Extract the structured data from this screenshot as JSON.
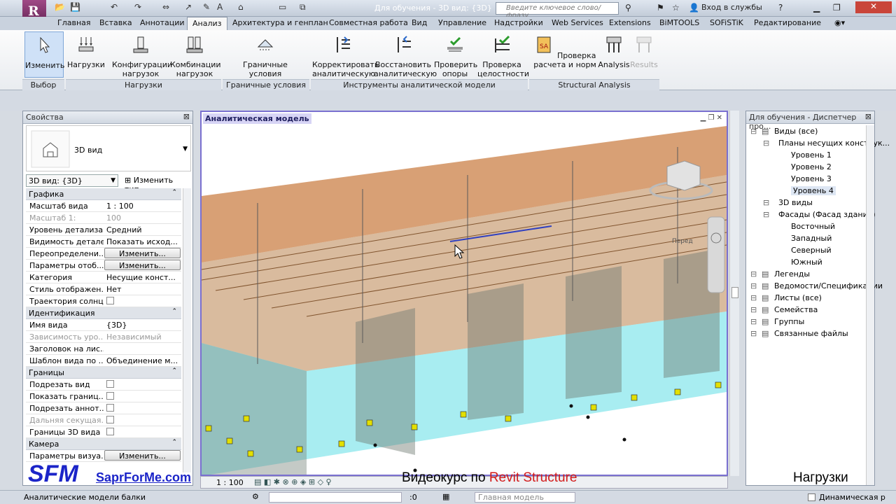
{
  "app": {
    "logo_letter": "R",
    "title": "Для обучения - 3D вид: {3D}",
    "search_placeholder": "Введите ключевое слово/фразу",
    "signin": "Вход в службы"
  },
  "tabs": [
    "Главная",
    "Вставка",
    "Аннотации",
    "Анализ",
    "Архитектура и генплан",
    "Совместная работа",
    "Вид",
    "Управление",
    "Надстройки",
    "Web Services",
    "Extensions",
    "BiMTOOLS",
    "SOFiSTiK",
    "Редактирование"
  ],
  "active_tab": "Анализ",
  "ribbon": {
    "buttons": [
      {
        "label": "Изменить",
        "icon": "cursor-icon"
      },
      {
        "label": "Нагрузки",
        "icon": "loads-icon"
      },
      {
        "label": "Конфигурации\nнагрузок",
        "icon": "load-configs-icon"
      },
      {
        "label": "Комбинации\nнагрузок",
        "icon": "load-combos-icon"
      },
      {
        "label": "Граничные\nусловия",
        "icon": "boundary-icon"
      },
      {
        "label": "Корректировать\nаналитическую",
        "icon": "adjust-icon"
      },
      {
        "label": "Восстановить\nаналитическую",
        "icon": "reset-icon"
      },
      {
        "label": "Проверить\nопоры",
        "icon": "check-supports-icon"
      },
      {
        "label": "Проверка\nцелостности",
        "icon": "consistency-icon"
      },
      {
        "label": "Проверка\nрасчета и норм",
        "icon": "code-check-icon"
      },
      {
        "label": "Analysis",
        "icon": "analysis-icon"
      },
      {
        "label": "Results",
        "icon": "results-icon"
      }
    ],
    "panels": [
      "Выбор",
      "Нагрузки",
      "Граничные условия",
      "Инструменты аналитической модели",
      "Structural Analysis"
    ]
  },
  "properties": {
    "title": "Свойства",
    "type_name": "3D вид",
    "view_selector": "3D вид: {3D}",
    "edit_type": "Изменить тип",
    "groups": {
      "graphics": "Графика",
      "identity": "Идентификация",
      "extents": "Границы",
      "camera": "Камера"
    },
    "rows": [
      {
        "k": "Масштаб вида",
        "v": "1 : 100"
      },
      {
        "k": "Масштаб   1:",
        "v": "100",
        "dis": true
      },
      {
        "k": "Уровень детализа...",
        "v": "Средний"
      },
      {
        "k": "Видимость деталей",
        "v": "Показать исход..."
      },
      {
        "k": "Переопределени...",
        "btn": "Изменить..."
      },
      {
        "k": "Параметры отоб...",
        "btn": "Изменить..."
      },
      {
        "k": "Категория",
        "v": "Несущие конст..."
      },
      {
        "k": "Стиль отображен...",
        "v": "Нет"
      },
      {
        "k": "Траектория солнца",
        "cb": true
      },
      {
        "k": "Имя вида",
        "v": "{3D}"
      },
      {
        "k": "Зависимость уро...",
        "v": "Независимый",
        "dis": true
      },
      {
        "k": "Заголовок на лис...",
        "v": ""
      },
      {
        "k": "Шаблон вида по ...",
        "v": "Объединение м..."
      },
      {
        "k": "Подрезать вид",
        "cb": true
      },
      {
        "k": "Показать границ...",
        "cb": true
      },
      {
        "k": "Подрезать аннот...",
        "cb": true
      },
      {
        "k": "Дальняя секущая...",
        "cb": true,
        "dis": true
      },
      {
        "k": "Границы 3D вида",
        "cb": true
      },
      {
        "k": "Параметры визуа...",
        "btn": "Изменить..."
      }
    ]
  },
  "viewport": {
    "title": "Аналитическая модель",
    "scale": "1 : 100",
    "view_cube_label": "Перед"
  },
  "browser": {
    "title": "Для обучения - Диспетчер про...",
    "items": [
      {
        "label": "Виды (все)",
        "lvl": 0
      },
      {
        "label": "Планы несущих конструк...",
        "lvl": 1
      },
      {
        "label": "Уровень 1",
        "lvl": 2
      },
      {
        "label": "Уровень 2",
        "lvl": 2
      },
      {
        "label": "Уровень 3",
        "lvl": 2
      },
      {
        "label": "Уровень 4",
        "lvl": 2,
        "sel": true
      },
      {
        "label": "3D виды",
        "lvl": 1
      },
      {
        "label": "Фасады (Фасад здания)",
        "lvl": 1
      },
      {
        "label": "Восточный",
        "lvl": 2
      },
      {
        "label": "Западный",
        "lvl": 2
      },
      {
        "label": "Северный",
        "lvl": 2
      },
      {
        "label": "Южный",
        "lvl": 2
      },
      {
        "label": "Легенды",
        "lvl": 0
      },
      {
        "label": "Ведомости/Спецификации",
        "lvl": 0
      },
      {
        "label": "Листы (все)",
        "lvl": 0
      },
      {
        "label": "Семейства",
        "lvl": 0
      },
      {
        "label": "Группы",
        "lvl": 0
      },
      {
        "label": "Связанные файлы",
        "lvl": 0
      }
    ]
  },
  "status": {
    "text": "Аналитические модели балки",
    "count": ":0",
    "model": "Главная модель",
    "dynamic": "Динамическая р"
  },
  "watermark": {
    "logo": "SFM",
    "site": "SaprForMe.com",
    "course_a": "Видеокурс по ",
    "course_b": "Revit Structure",
    "topic": "Нагрузки"
  },
  "colors": {
    "tab_active": "#f7f7f7",
    "viewport_border": "#7a70d0",
    "slab": "#c8773a",
    "wall": "#3fd7df",
    "course_red": "#d21a1a",
    "site_blue": "#1b24c8"
  }
}
